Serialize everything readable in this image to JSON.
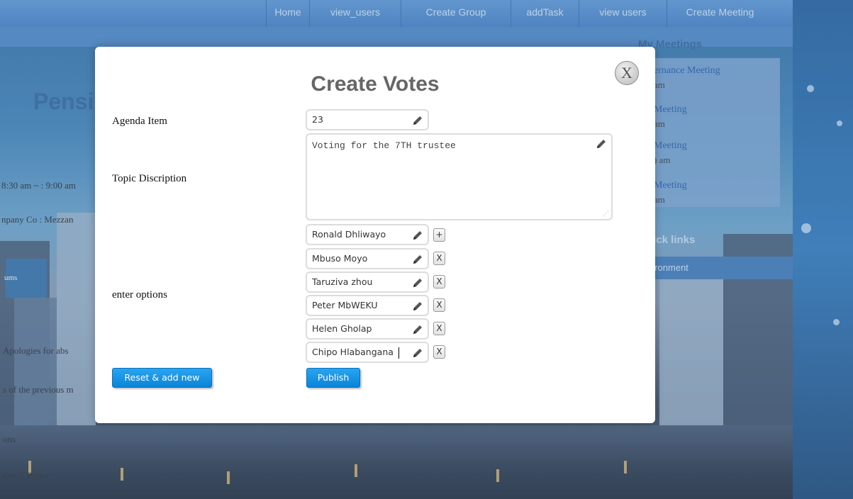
{
  "nav": {
    "items": [
      "Home",
      "view_users",
      "Create Group",
      "addTask",
      "view users",
      "Create Meeting"
    ]
  },
  "background": {
    "page_title_partial": "Pensi",
    "time_fragment": "8:30 am ~ : 9:00 am",
    "company_fragment": "npany Co : Mezzan",
    "label_fragment": "ums",
    "apologies_fragment": "Apologies for abs",
    "minutes_fragment": "s of the previous m",
    "ons_fragment": "ons",
    "report_fragment": "tive S Repor",
    "sidebar": {
      "title": "My Meetings",
      "meetings": [
        {
          "name": "ernance Meeting",
          "time": "am"
        },
        {
          "name": "Meeting",
          "time": "am"
        },
        {
          "name": "Meeting",
          "time": ") am"
        },
        {
          "name": "Meeting",
          "time": "am"
        }
      ],
      "quick_links": "uick links",
      "environment": "nronment"
    }
  },
  "modal": {
    "title": "Create Votes",
    "close_label": "X",
    "agenda_label": "Agenda Item",
    "agenda_value": "23",
    "topic_label": "Topic Discription",
    "topic_value": "Voting for the 7TH trustee",
    "options_label": "enter options",
    "options": [
      "Ronald Dhliwayo",
      "Mbuso Moyo",
      "Taruziva zhou",
      "Peter MbWEKU",
      "Helen Gholap",
      "Chipo Hlabangana"
    ],
    "add_option_label": "+",
    "remove_option_label": "X",
    "reset_button": "Reset & add new",
    "publish_button": "Publish"
  }
}
